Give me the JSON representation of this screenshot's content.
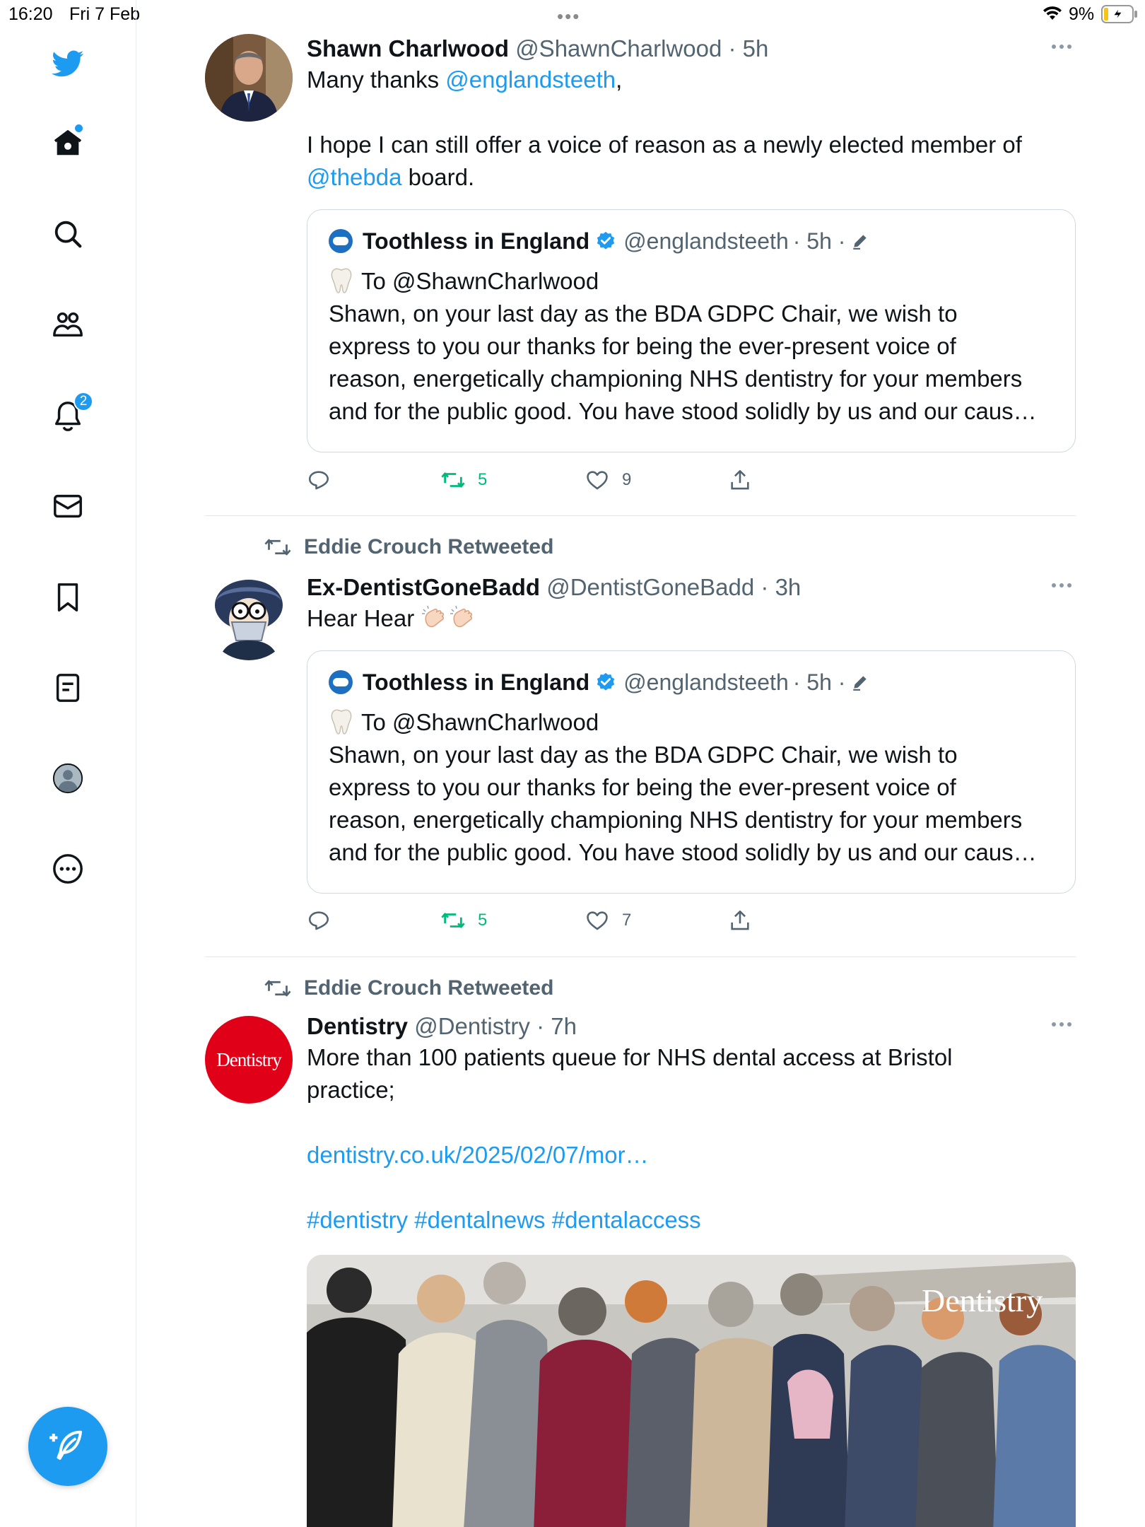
{
  "status_bar": {
    "time": "16:20",
    "date": "Fri 7 Feb",
    "battery": "9%"
  },
  "sidebar": {
    "items": [
      {
        "name": "home",
        "label": "Home"
      },
      {
        "name": "explore",
        "label": "Explore"
      },
      {
        "name": "communities",
        "label": "Communities"
      },
      {
        "name": "notifications",
        "label": "Notifications",
        "badge": "2"
      },
      {
        "name": "messages",
        "label": "Messages"
      },
      {
        "name": "bookmarks",
        "label": "Bookmarks"
      },
      {
        "name": "lists",
        "label": "Lists"
      },
      {
        "name": "profile",
        "label": "Profile"
      },
      {
        "name": "more",
        "label": "More"
      }
    ],
    "notifications_badge": "2",
    "accent_color": "#1d9bf0"
  },
  "tweets": [
    {
      "name": "Shawn Charlwood",
      "handle": "@ShawnCharlwood",
      "time": "· 5h",
      "text_line1_prefix": "Many thanks ",
      "text_line1_mention": "@englandsteeth",
      "text_line1_suffix": ",",
      "text_line2": "I hope I can still offer a voice of reason as a newly elected member of",
      "text_line3_mention": "@thebda",
      "text_line3_suffix": " board.",
      "quote": {
        "name": "Toothless in England",
        "handle": "@englandsteeth",
        "time": "· 5h ·",
        "line1": "To @ShawnCharlwood",
        "line2": "Shawn, on your last day as the BDA GDPC Chair, we wish to",
        "line3": "express to you our thanks for being the ever-present voice of",
        "line4": "reason, energetically championing NHS dentistry for your members",
        "line5": "and for the public good. You have stood solidly by us and our caus…"
      },
      "retweets": "5",
      "likes": "9"
    },
    {
      "retweeted_by": "Eddie Crouch Retweeted",
      "name": "Ex-DentistGoneBadd",
      "handle": "@DentistGoneBadd",
      "time": "· 3h",
      "text": "Hear Hear",
      "quote": {
        "name": "Toothless in England",
        "handle": "@englandsteeth",
        "time": "· 5h ·",
        "line1": "To @ShawnCharlwood",
        "line2": "Shawn, on your last day as the BDA GDPC Chair, we wish to",
        "line3": "express to you our thanks for being the ever-present voice of",
        "line4": "reason, energetically championing NHS dentistry for your members",
        "line5": "and for the public good. You have stood solidly by us and our caus…"
      },
      "retweets": "5",
      "likes": "7"
    },
    {
      "retweeted_by": "Eddie Crouch Retweeted",
      "name": "Dentistry",
      "handle": "@Dentistry",
      "time": "· 7h",
      "avatar_text": "Dentistry",
      "text_line1": "More than 100 patients queue for NHS dental access at Bristol",
      "text_line2": "practice;",
      "link": "dentistry.co.uk/2025/02/07/mor…",
      "hashtags": "#dentistry #dentalnews #dentalaccess",
      "media_watermark": "Dentistry"
    }
  ]
}
